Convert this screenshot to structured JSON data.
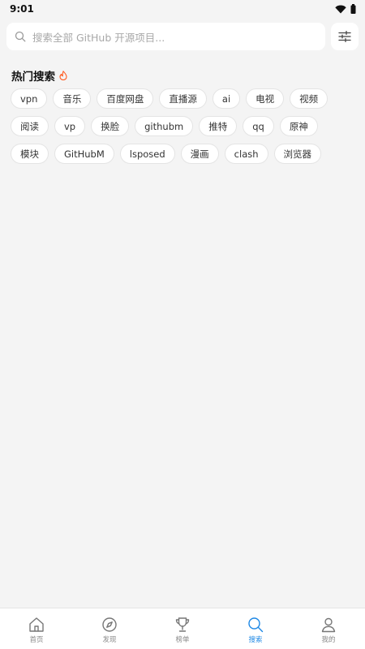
{
  "status_bar": {
    "time": "9:01"
  },
  "search": {
    "placeholder": "搜索全部 GitHub 开源项目..."
  },
  "hot": {
    "title": "热门搜索",
    "tags": [
      "vpn",
      "音乐",
      "百度网盘",
      "直播源",
      "ai",
      "电视",
      "视频",
      "阅读",
      "vp",
      "换脸",
      "githubm",
      "推特",
      "qq",
      "原神",
      "模块",
      "GitHubM",
      "lsposed",
      "漫画",
      "clash",
      "浏览器"
    ]
  },
  "nav": {
    "items": [
      {
        "label": "首页",
        "icon": "home-icon"
      },
      {
        "label": "发现",
        "icon": "compass-icon"
      },
      {
        "label": "榜单",
        "icon": "trophy-icon"
      },
      {
        "label": "搜索",
        "icon": "search-icon",
        "active": true
      },
      {
        "label": "我的",
        "icon": "user-icon"
      }
    ]
  },
  "colors": {
    "accent": "#1e88e5",
    "fire": "#ff5a1f",
    "background": "#f4f4f4"
  }
}
